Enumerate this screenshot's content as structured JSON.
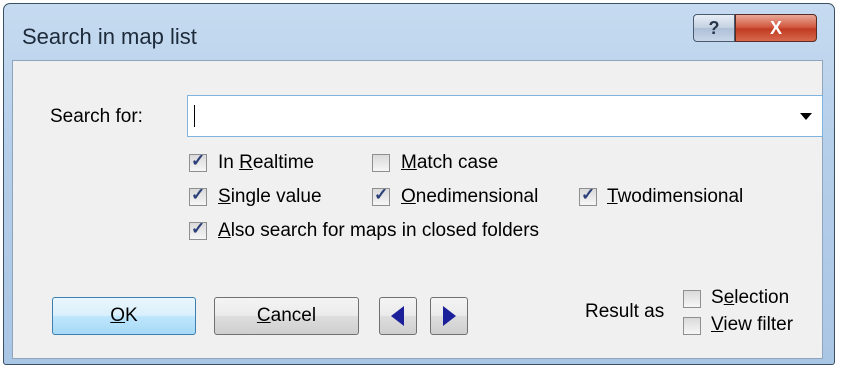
{
  "window": {
    "title": "Search in map list",
    "help_glyph": "?",
    "close_glyph": "X"
  },
  "search": {
    "label": "Search for:",
    "value": ""
  },
  "options": {
    "in_realtime": {
      "label_pre": "In ",
      "label_ul": "R",
      "label_post": "ealtime",
      "checked": true
    },
    "match_case": {
      "label_pre": "",
      "label_ul": "M",
      "label_post": "atch case",
      "checked": false
    },
    "single_value": {
      "label_pre": "",
      "label_ul": "S",
      "label_post": "ingle value",
      "checked": true
    },
    "onedimensional": {
      "label_pre": "",
      "label_ul": "O",
      "label_post": "nedimensional",
      "checked": true
    },
    "twodimensional": {
      "label_pre": "",
      "label_ul": "T",
      "label_post": "wodimensional",
      "checked": true
    },
    "closed_folders": {
      "label_pre": "",
      "label_ul": "A",
      "label_post": "lso search for maps in closed folders",
      "checked": true
    }
  },
  "buttons": {
    "ok": {
      "ul": "O",
      "rest": "K"
    },
    "cancel": {
      "ul": "C",
      "rest": "ancel"
    }
  },
  "result": {
    "label": "Result as",
    "selection": {
      "label_pre": "S",
      "label_ul": "e",
      "label_post": "lection",
      "checked": false
    },
    "view_filter": {
      "label_pre": "",
      "label_ul": "V",
      "label_post": "iew filter",
      "checked": false
    }
  },
  "check_glyph": "✓"
}
